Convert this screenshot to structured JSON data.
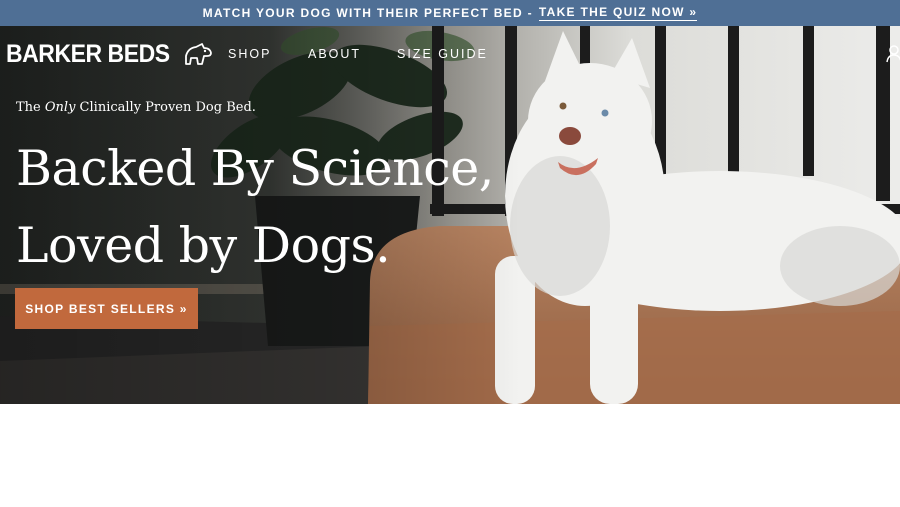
{
  "announcement": {
    "message": "MATCH YOUR DOG WITH THEIR PERFECT BED -",
    "link_label": "TAKE THE QUIZ NOW »"
  },
  "header": {
    "logo_text": "BARKER BEDS",
    "nav": [
      {
        "label": "SHOP"
      },
      {
        "label": "ABOUT"
      },
      {
        "label": "SIZE GUIDE"
      }
    ]
  },
  "hero": {
    "tagline_prefix": "The ",
    "tagline_emphasis": "Only",
    "tagline_suffix": " Clinically Proven Dog Bed.",
    "headline_line1": "Backed By Science,",
    "headline_line2": "Loved by Dogs.",
    "cta_label": "SHOP BEST SELLERS »"
  },
  "colors": {
    "announcement_bg": "#4f6f95",
    "cta_bg": "#c1693d",
    "text_light": "#ffffff"
  },
  "icons": [
    "dog-logo-icon",
    "account-icon"
  ]
}
